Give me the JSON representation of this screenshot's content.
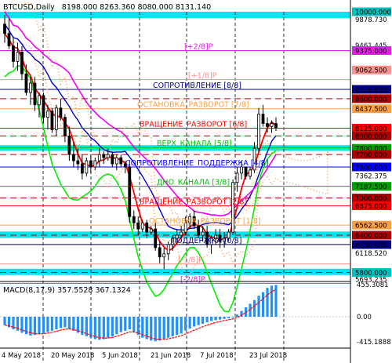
{
  "header": {
    "symbol": "BTCUSD,Daily",
    "ohlc": "8198.000 8263.360 8080.000 8131.140"
  },
  "macd": {
    "label": "MACD(8,17,9) 357.5528 367.1324",
    "scale": [
      "455.3081",
      "0.00",
      "-415.1888"
    ]
  },
  "x_axis": [
    "4 May 2018",
    "20 May 2018",
    "5 Jun 2018",
    "21 Jun 2018",
    "7 Jul 2018",
    "23 Jul 2018"
  ],
  "murrey_lines": [
    {
      "label": "[+2/8]P",
      "price": 9375.0,
      "color": "#e020e0"
    },
    {
      "label": "[+1/8]P",
      "price": 8906.0,
      "color": "#ff9090"
    },
    {
      "label": "СОПРОТИВЛЕНИЕ [8/8]",
      "price": 8750.0,
      "color": "#000080"
    },
    {
      "label": "ОСТАНОВКА_РАЗВОРОТ [7/8]",
      "price": 8437.5,
      "color": "#ffa040"
    },
    {
      "label": "ВРАЩЕНИЕ_РАЗВОРОТ [6/8]",
      "price": 8125.0,
      "color": "#ff0000"
    },
    {
      "label": "ВЕРХ_КАНАЛА [5/8]",
      "price": 7812.5,
      "color": "#00c000"
    },
    {
      "label": "СОПРОТИВЛЕНИЕ_ПОДДЕРЖКА [4/8]",
      "price": 7500.0,
      "color": "#0000ff"
    },
    {
      "label": "ДНО_КАНАЛА [3/8]",
      "price": 7187.5,
      "color": "#00c000"
    },
    {
      "label": "ВРАЩЕНИЕ_РАЗВОРОТ [2/8]",
      "price": 6875.0,
      "color": "#ff0000"
    },
    {
      "label": "ОСТАНОВКА_РАЗВОРОТ [1/8]",
      "price": 6562.5,
      "color": "#ffa040"
    },
    {
      "label": "ПОДДЕРЖКА [0/8]",
      "price": 6250.0,
      "color": "#000080"
    },
    {
      "label": "[-1/8]P",
      "price": 5937.5,
      "color": "#ff9090"
    },
    {
      "label": "[-2/8]P",
      "price": 5625.0,
      "color": "#e020e0"
    }
  ],
  "price_scale": [
    {
      "text": "10000.000",
      "price": 10000,
      "bg": "#00c0c0",
      "fg": "#000000"
    },
    {
      "text": "9878.730",
      "price": 9878.73,
      "bg": "",
      "fg": "#000000"
    },
    {
      "text": "9461.445",
      "price": 9461.445,
      "bg": "",
      "fg": "#000000"
    },
    {
      "text": "9375.000",
      "price": 9375,
      "bg": "#e020e0",
      "fg": "#ffffff"
    },
    {
      "text": "9062.500",
      "price": 9062.5,
      "bg": "#ff9090",
      "fg": "#ffffff"
    },
    {
      "text": "8750.000",
      "price": 8750,
      "bg": "#000080",
      "fg": "#ffffff"
    },
    {
      "text": "8600.000",
      "price": 8600,
      "bg": "#b00000",
      "fg": "#ffffff"
    },
    {
      "text": "8437.500",
      "price": 8437.5,
      "bg": "#ffa040",
      "fg": "#ffffff"
    },
    {
      "text": "8125.000",
      "price": 8125,
      "bg": "#ff0000",
      "fg": "#ffffff"
    },
    {
      "text": "8000.000",
      "price": 8000,
      "bg": "#b00000",
      "fg": "#ffffff"
    },
    {
      "text": "7800.000",
      "price": 7800,
      "bg": "#00a000",
      "fg": "#ffffff"
    },
    {
      "text": "7700.000",
      "price": 7700,
      "bg": "#b00000",
      "fg": "#ffffff"
    },
    {
      "text": "7500.000",
      "price": 7500,
      "bg": "#0000ff",
      "fg": "#ffffff"
    },
    {
      "text": "7362.375",
      "price": 7362.375,
      "bg": "",
      "fg": "#000000"
    },
    {
      "text": "7187.500",
      "price": 7187.5,
      "bg": "#00a000",
      "fg": "#ffffff"
    },
    {
      "text": "7000.000",
      "price": 7000,
      "bg": "#b00000",
      "fg": "#ffffff"
    },
    {
      "text": "6875.000",
      "price": 6875,
      "bg": "#ff0000",
      "fg": "#ffffff"
    },
    {
      "text": "6562.500",
      "price": 6562.5,
      "bg": "#ffa040",
      "fg": "#ffffff"
    },
    {
      "text": "6400.000",
      "price": 6400,
      "bg": "#b00000",
      "fg": "#ffffff"
    },
    {
      "text": "6250.000",
      "price": 6250,
      "bg": "#000080",
      "fg": "#ffffff"
    },
    {
      "text": "6118.520",
      "price": 6118.52,
      "bg": "",
      "fg": "#000000"
    },
    {
      "text": "5800.000",
      "price": 5800,
      "bg": "#00c0c0",
      "fg": "#000000"
    },
    {
      "text": "5693.235",
      "price": 5693.235,
      "bg": "",
      "fg": "#000000"
    }
  ],
  "colors": {
    "band_cyan": "#00e5f0",
    "dark_red": "#b00000",
    "ma_red": "#ff0000",
    "ma_blue": "#0000cc",
    "ma_green": "#00ee00",
    "ma_magenta": "#ee00ee",
    "macd_bar": "#1e90ff",
    "macd_signal": "#ff0000"
  },
  "chart_data": {
    "type": "candlestick",
    "xlabels": [
      "4 May 2018",
      "20 May 2018",
      "5 Jun 2018",
      "21 Jun 2018",
      "7 Jul 2018",
      "23 Jul 2018"
    ],
    "ylim": [
      5693.235,
      10000
    ],
    "candles": [
      [
        9800,
        9950,
        9500,
        9650
      ],
      [
        9650,
        9900,
        9400,
        9450
      ],
      [
        9450,
        9600,
        9100,
        9200
      ],
      [
        9200,
        9500,
        9050,
        9350
      ],
      [
        9350,
        9450,
        8900,
        9000
      ],
      [
        9000,
        9150,
        8650,
        8700
      ],
      [
        8700,
        8950,
        8500,
        8850
      ],
      [
        8850,
        8950,
        8400,
        8500
      ],
      [
        8500,
        8700,
        8300,
        8650
      ],
      [
        8650,
        8700,
        8200,
        8300
      ],
      [
        8300,
        8500,
        8100,
        8400
      ],
      [
        8400,
        8450,
        8050,
        8100
      ],
      [
        8100,
        8500,
        8000,
        8450
      ],
      [
        8450,
        8600,
        8250,
        8300
      ],
      [
        8300,
        8350,
        7900,
        8000
      ],
      [
        8000,
        8150,
        7600,
        7700
      ],
      [
        7700,
        7900,
        7500,
        7600
      ],
      [
        7600,
        7800,
        7450,
        7550
      ],
      [
        7550,
        7700,
        7300,
        7400
      ],
      [
        7400,
        7650,
        7350,
        7600
      ],
      [
        7600,
        7700,
        7400,
        7500
      ],
      [
        7500,
        7650,
        7450,
        7600
      ],
      [
        7600,
        7800,
        7500,
        7700
      ],
      [
        7700,
        7750,
        7550,
        7650
      ],
      [
        7650,
        7800,
        7600,
        7700
      ],
      [
        7700,
        7750,
        7500,
        7550
      ],
      [
        7550,
        7700,
        7450,
        7650
      ],
      [
        7650,
        7700,
        7500,
        7550
      ],
      [
        7550,
        7600,
        7400,
        7500
      ],
      [
        7500,
        7600,
        6600,
        6700
      ],
      [
        6700,
        6800,
        6500,
        6600
      ],
      [
        6600,
        6700,
        6400,
        6500
      ],
      [
        6500,
        6650,
        6450,
        6600
      ],
      [
        6600,
        6650,
        6350,
        6450
      ],
      [
        6450,
        6550,
        6400,
        6500
      ],
      [
        6500,
        6600,
        6150,
        6200
      ],
      [
        6200,
        6300,
        5950,
        6050
      ],
      [
        6050,
        6200,
        5850,
        6100
      ],
      [
        6100,
        6300,
        6000,
        6250
      ],
      [
        6250,
        6400,
        6150,
        6350
      ],
      [
        6350,
        6500,
        6250,
        6400
      ],
      [
        6400,
        6550,
        6350,
        6450
      ],
      [
        6450,
        6700,
        6400,
        6600
      ],
      [
        6600,
        6750,
        6500,
        6700
      ],
      [
        6700,
        6800,
        6500,
        6550
      ],
      [
        6550,
        6650,
        6350,
        6400
      ],
      [
        6400,
        6550,
        6300,
        6450
      ],
      [
        6450,
        6550,
        6200,
        6250
      ],
      [
        6250,
        6400,
        6100,
        6350
      ],
      [
        6350,
        6500,
        6250,
        6400
      ],
      [
        6400,
        6500,
        6200,
        6300
      ],
      [
        6300,
        6450,
        6200,
        6350
      ],
      [
        6350,
        6500,
        6300,
        6450
      ],
      [
        6450,
        7300,
        6400,
        7250
      ],
      [
        7250,
        7500,
        7100,
        7400
      ],
      [
        7400,
        7600,
        7300,
        7500
      ],
      [
        7500,
        7450,
        7300,
        7350
      ],
      [
        7350,
        7500,
        7300,
        7450
      ],
      [
        7450,
        7900,
        7400,
        7800
      ],
      [
        7800,
        8450,
        7750,
        8350
      ],
      [
        8350,
        8500,
        8150,
        8200
      ],
      [
        8200,
        8300,
        8050,
        8150
      ],
      [
        8150,
        8250,
        8050,
        8200
      ],
      [
        8200,
        8300,
        8080,
        8131
      ]
    ],
    "indicators": [
      "MA red",
      "MA blue",
      "MA green",
      "Murrey magenta"
    ],
    "macd_histogram": [
      -120,
      -150,
      -180,
      -200,
      -230,
      -250,
      -270,
      -260,
      -250,
      -240,
      -220,
      -200,
      -180,
      -160,
      -150,
      -170,
      -200,
      -230,
      -260,
      -280,
      -300,
      -320,
      -330,
      -320,
      -300,
      -280,
      -250,
      -220,
      -200,
      -180,
      -220,
      -260,
      -300,
      -320,
      -340,
      -350,
      -340,
      -320,
      -300,
      -280,
      -260,
      -240,
      -200,
      -170,
      -140,
      -120,
      -100,
      -80,
      -60,
      -50,
      -40,
      -30,
      -20,
      -10,
      30,
      80,
      130,
      180,
      230,
      290,
      340,
      400,
      430,
      440
    ]
  }
}
